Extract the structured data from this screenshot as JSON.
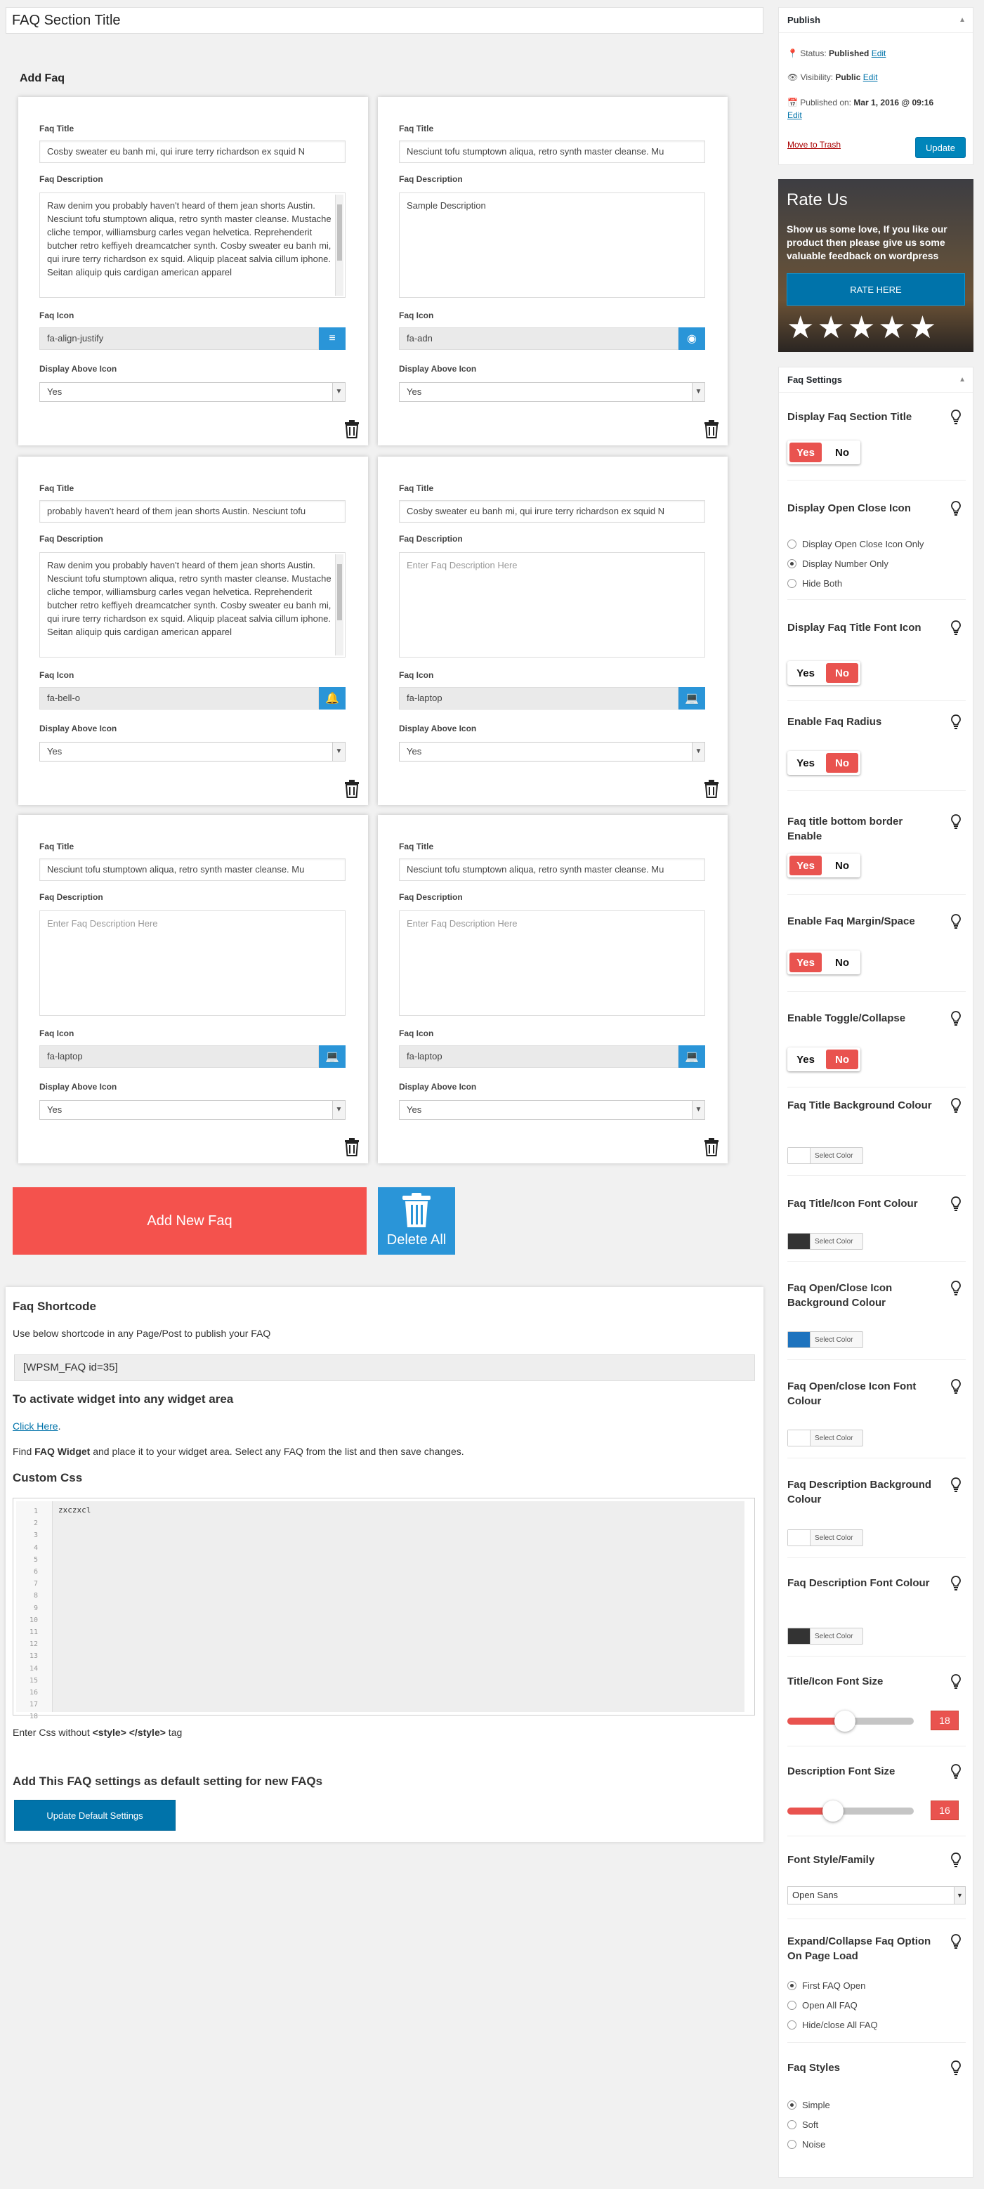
{
  "page": {
    "section_title": "FAQ Section Title",
    "add_faq_heading": "Add Faq"
  },
  "labels": {
    "faq_title": "Faq Title",
    "faq_description": "Faq Description",
    "faq_icon": "Faq Icon",
    "display_above_icon": "Display Above Icon"
  },
  "faqs": [
    {
      "title": "Cosby sweater eu banh mi, qui irure terry richardson ex squid N",
      "description": "Raw denim you probably haven't heard of them jean shorts Austin. Nesciunt tofu stumptown aliqua, retro synth master cleanse. Mustache cliche tempor, williamsburg carles vegan helvetica. Reprehenderit butcher retro keffiyeh dreamcatcher synth. Cosby sweater eu banh mi, qui irure terry richardson ex squid. Aliquip placeat salvia cillum iphone. Seitan aliquip quis cardigan american apparel",
      "icon": "fa-align-justify",
      "icon_glyph": "≡",
      "display_above_icon": "Yes"
    },
    {
      "title": "Nesciunt tofu stumptown aliqua, retro synth master cleanse. Mu",
      "description": "Sample Description",
      "icon": "fa-adn",
      "icon_glyph": "◉",
      "display_above_icon": "Yes"
    },
    {
      "title": "probably haven't heard of them jean shorts Austin. Nesciunt tofu",
      "description": "Raw denim you probably haven't heard of them jean shorts Austin. Nesciunt tofu stumptown aliqua, retro synth master cleanse. Mustache cliche tempor, williamsburg carles vegan helvetica. Reprehenderit butcher retro keffiyeh dreamcatcher synth. Cosby sweater eu banh mi, qui irure terry richardson ex squid. Aliquip placeat salvia cillum iphone. Seitan aliquip quis cardigan american apparel",
      "icon": "fa-bell-o",
      "icon_glyph": "🔔",
      "display_above_icon": "Yes"
    },
    {
      "title": "Cosby sweater eu banh mi, qui irure terry richardson ex squid N",
      "description": "",
      "icon": "fa-laptop",
      "icon_glyph": "💻",
      "display_above_icon": "Yes"
    },
    {
      "title": "Nesciunt tofu stumptown aliqua, retro synth master cleanse. Mu",
      "description": "",
      "icon": "fa-laptop",
      "icon_glyph": "💻",
      "display_above_icon": "Yes"
    },
    {
      "title": "Nesciunt tofu stumptown aliqua, retro synth master cleanse. Mu",
      "description": "",
      "icon": "fa-laptop",
      "icon_glyph": "💻",
      "display_above_icon": "Yes"
    }
  ],
  "description_placeholder": "Enter Faq Description Here",
  "buttons": {
    "add_new": "Add New Faq",
    "delete_all": "Delete All",
    "update_default": "Update Default Settings"
  },
  "shortcode": {
    "heading": "Faq Shortcode",
    "instruction": "Use below shortcode in any Page/Post to publish your FAQ",
    "value": "[WPSM_FAQ id=35]",
    "widget_heading": "To activate widget into any widget area",
    "click_here": "Click Here",
    "find_prefix": "Find ",
    "find_bold": "FAQ Widget",
    "find_suffix": " and place it to your widget area. Select any FAQ from the list and then save changes.",
    "custom_css_heading": "Custom Css",
    "css_code": "zxczxcl",
    "css_note_prefix": "Enter Css without ",
    "css_note_bold": "<style> </style>",
    "css_note_suffix": " tag",
    "default_heading": "Add This FAQ settings as default setting for new FAQs"
  },
  "publish": {
    "title": "Publish",
    "status_label": "Status:",
    "status_value": "Published",
    "visibility_label": "Visibility:",
    "visibility_value": "Public",
    "published_label": "Published on:",
    "published_value": "Mar 1, 2016 @ 09:16",
    "edit": "Edit",
    "trash": "Move to Trash",
    "update": "Update"
  },
  "rate": {
    "title": "Rate Us",
    "text": "Show us some love, If you like our product then please give us some valuable feedback on wordpress",
    "button": "RATE HERE",
    "stars": "★★★★★"
  },
  "settings": {
    "title": "Faq Settings",
    "yes": "Yes",
    "no": "No",
    "select_color": "Select Color",
    "display_section_title": "Display Faq Section Title",
    "display_open_close_icon": "Display Open Close Icon",
    "open_close_options": [
      "Display Open Close Icon Only",
      "Display Number Only",
      "Hide Both"
    ],
    "display_title_font_icon": "Display Faq Title Font Icon",
    "enable_radius": "Enable Faq Radius",
    "title_bottom_border": "Faq title bottom border Enable",
    "enable_margin": "Enable Faq Margin/Space",
    "enable_toggle": "Enable Toggle/Collapse",
    "title_bg_colour": "Faq Title Background Colour",
    "title_icon_font_colour": "Faq Title/Icon Font Colour",
    "open_close_bg_colour": "Faq Open/Close Icon Background Colour",
    "open_close_font_colour": "Faq Open/close Icon Font Colour",
    "desc_bg_colour": "Faq Description Background Colour",
    "desc_font_colour": "Faq Description Font Colour",
    "title_font_size_label": "Title/Icon Font Size",
    "title_font_size": "18",
    "desc_font_size_label": "Description Font Size",
    "desc_font_size": "16",
    "font_family_label": "Font Style/Family",
    "font_family": "Open Sans",
    "expand_label": "Expand/Collapse Faq Option On Page Load",
    "expand_options": [
      "First FAQ Open",
      "Open All FAQ",
      "Hide/close All FAQ"
    ],
    "styles_label": "Faq Styles",
    "style_options": [
      "Simple",
      "Soft",
      "Noise"
    ]
  },
  "colors": {
    "accent_red": "#e9534f",
    "accent_blue": "#2a95d8",
    "swatch_white": "#ffffff",
    "swatch_dark": "#333333",
    "swatch_blue": "#1e73be"
  }
}
